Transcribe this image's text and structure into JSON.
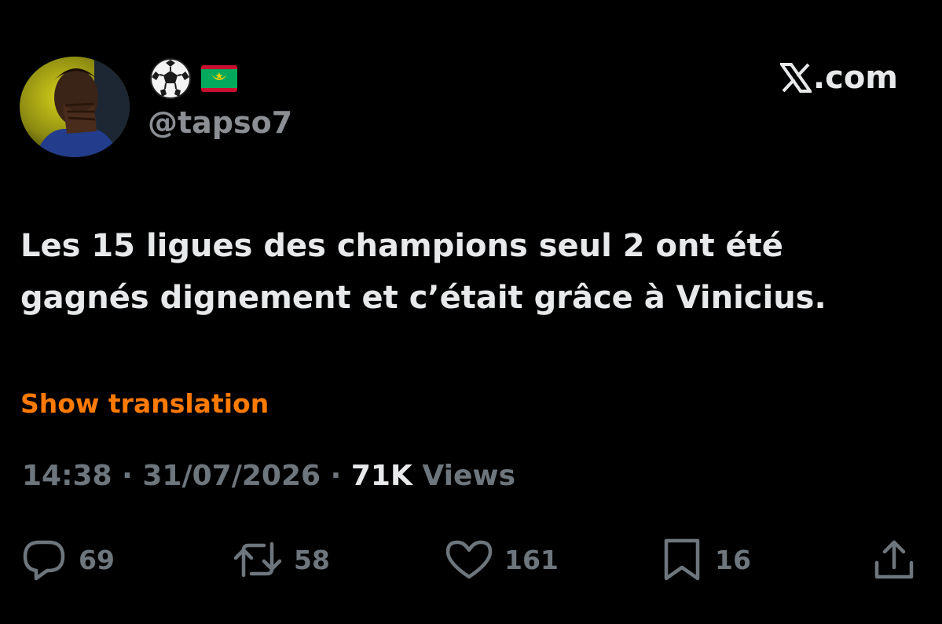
{
  "header": {
    "display_name_icons": [
      "soccer-ball-icon",
      "mauritania-flag-icon"
    ],
    "handle": "@tapso7",
    "brand": ".com"
  },
  "tweet": {
    "text_lines": [
      "Les 15 ligues des champions seul 2 ont été",
      "gagnés dignement et c’était grâce à Vinicius."
    ],
    "show_translation": "Show translation"
  },
  "meta": {
    "time": "14:38",
    "separator": "·",
    "date": "31/07/2026",
    "views_count": "71K",
    "views_label": "Views"
  },
  "actions": {
    "replies": "69",
    "reposts": "58",
    "likes": "161",
    "bookmarks": "16"
  },
  "colors": {
    "background": "#000000",
    "text": "#e7e9ea",
    "muted": "#6e767d",
    "accent": "#ff7a00"
  }
}
